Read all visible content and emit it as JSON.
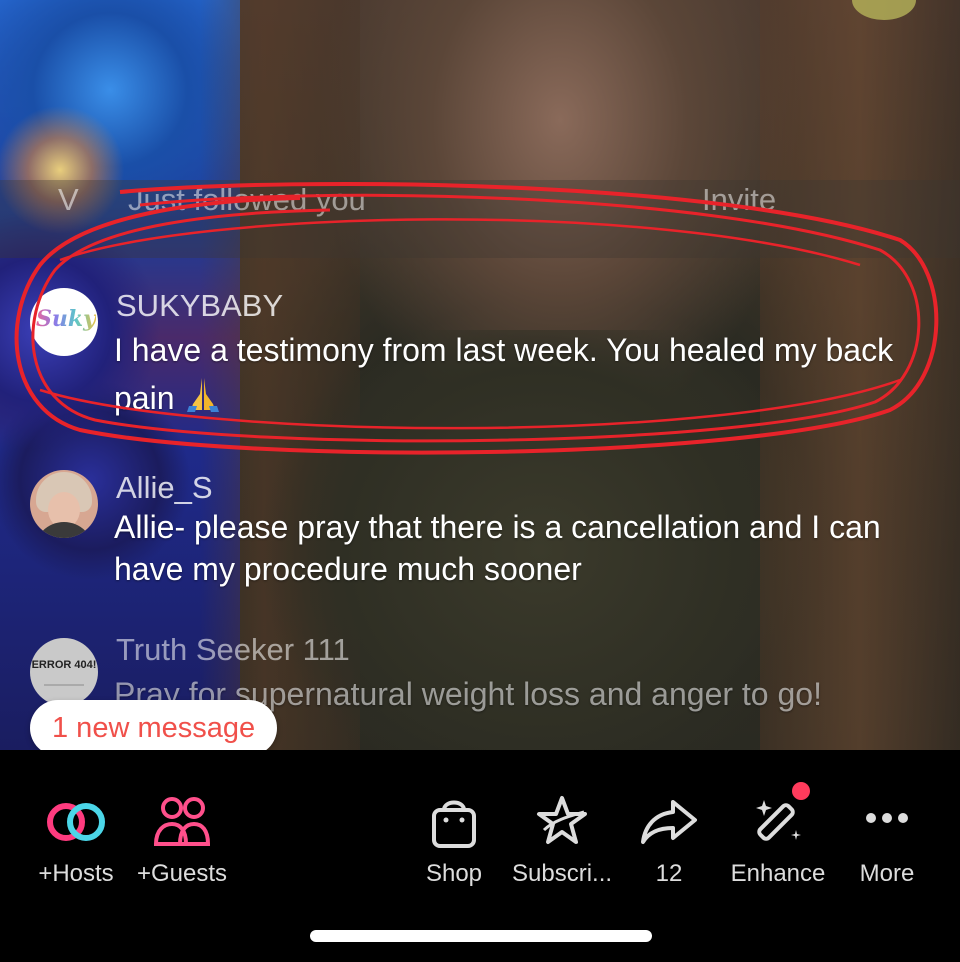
{
  "top_row": {
    "initial": "V",
    "notice": "Just followed you",
    "invite": "Invite"
  },
  "comments": [
    {
      "username": "SUKYBABY",
      "avatar_text": "Suky",
      "avatar_icon": "sukybaby-avatar",
      "message": "I have a testimony from last week. You healed my back pain",
      "emoji": "🙏"
    },
    {
      "username": "Allie_S",
      "avatar_icon": "allie-avatar",
      "message": "Allie- please pray that there is a cancellation and I can have my procedure much sooner"
    },
    {
      "username": "Truth Seeker 111",
      "avatar_text": "ERROR 404!",
      "avatar_icon": "error-404-avatar",
      "message": "Pray for supernatural weight loss and anger to go!"
    }
  ],
  "new_message_pill": "1 new message",
  "toolbar": {
    "hosts": "+Hosts",
    "guests": "+Guests",
    "shop": "Shop",
    "subscribe": "Subscri...",
    "share_count": "12",
    "enhance": "Enhance",
    "more": "More"
  },
  "colors": {
    "annotation_red": "#e8232a",
    "pill_text": "#f0504a",
    "hosts_pink": "#ff3b7f",
    "hosts_cyan": "#4bd6e8",
    "guests_pink": "#ff4f8b",
    "badge": "#ff3b5c"
  }
}
